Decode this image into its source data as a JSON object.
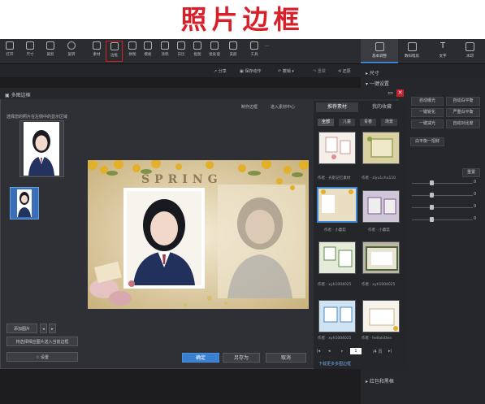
{
  "banner": {
    "title": "照片边框"
  },
  "toolbar": {
    "items": [
      "打开",
      "尺寸",
      "裁剪",
      "旋转",
      "素材",
      "边框",
      "拼图",
      "模板",
      "涂鸦",
      "日历",
      "抠图",
      "批处理",
      "美颜",
      "工具"
    ],
    "more": "···"
  },
  "right_tabs": [
    "基本调整",
    "数码暗房",
    "文字",
    "水印"
  ],
  "subbar": {
    "share": "分享",
    "save_record": "保存动作",
    "undo": "撤销",
    "redo": "重做",
    "restore": "还原"
  },
  "right_panel": {
    "section_size": "▸ 尺寸",
    "section_quick": "▾ 一键设置",
    "buttons": [
      [
        "自动曝光",
        "自动白平衡"
      ],
      [
        "一键锐化",
        "严重白平衡"
      ],
      [
        "一键减光",
        "自动对比度"
      ]
    ],
    "extra": "白平衡一招鲜",
    "reset": "重置",
    "slider_values": [
      "0",
      "0",
      "0",
      "0",
      "0"
    ],
    "bottom_section": "▸ 红包和黑框"
  },
  "dialog": {
    "title": "多图边框",
    "instruction": "选择您的照片在左侧中的显示区域",
    "tabs_top": [
      "制作边框",
      "进入素材中心"
    ],
    "add_photo": "添加图片",
    "apply_all": "将选择相应图片送入当前边框",
    "settings": "设置",
    "ok": "确定",
    "save_as": "另存为",
    "cancel": "取消"
  },
  "materials": {
    "tabs": [
      "推荐素材",
      "我的收藏"
    ],
    "filters": [
      "全部",
      "儿童",
      "青春",
      "场景"
    ],
    "captions": [
      "作者 · 光影记忆素材",
      "作者 · ziyu1chu110",
      "作者 · 小蘑菇",
      "作者 · 小蘑菇",
      "作者 · xyh1004025",
      "作者 · xyh1004025",
      "作者 · xyh1004025",
      "作者 · hellokitten"
    ],
    "page": "1",
    "total": "/4 页",
    "more_link": "下载更多多图边框"
  },
  "canvas_text": "SPRING",
  "colors": {
    "accent": "#3a7fd0",
    "banner_red": "#d8202a",
    "highlight": "#d2202a"
  }
}
